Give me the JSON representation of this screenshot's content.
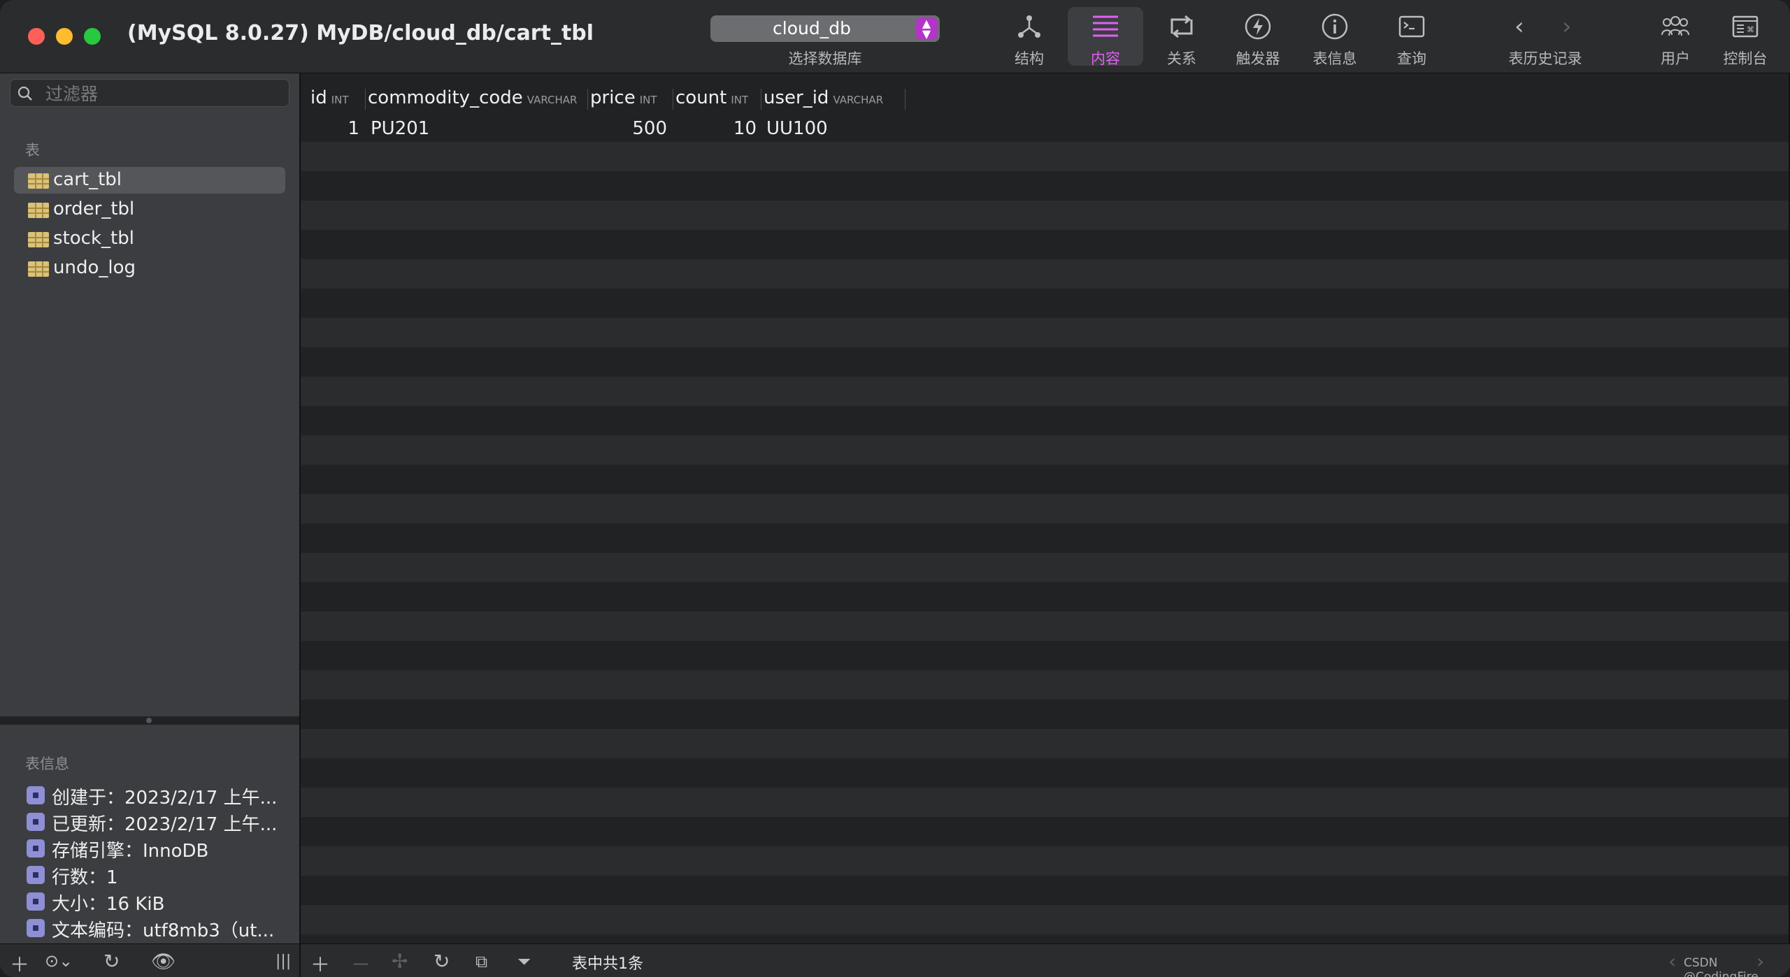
{
  "window": {
    "title": "(MySQL 8.0.27) MyDB/cloud_db/cart_tbl"
  },
  "toolbar": {
    "database": {
      "selected": "cloud_db",
      "label": "选择数据库"
    },
    "tools": [
      {
        "id": "structure",
        "label": "结构",
        "icon": "structure-icon",
        "active": false
      },
      {
        "id": "content",
        "label": "内容",
        "icon": "content-list-icon",
        "active": true
      },
      {
        "id": "relations",
        "label": "关系",
        "icon": "relations-icon",
        "active": false
      },
      {
        "id": "triggers",
        "label": "触发器",
        "icon": "trigger-bolt-icon",
        "active": false
      },
      {
        "id": "tableinfo",
        "label": "表信息",
        "icon": "info-icon",
        "active": false
      },
      {
        "id": "query",
        "label": "查询",
        "icon": "terminal-icon",
        "active": false
      }
    ],
    "history_label": "表历史记录",
    "users_label": "用户",
    "console_label": "控制台"
  },
  "sidebar": {
    "filter_placeholder": "过滤器",
    "tables_header": "表",
    "tables": [
      {
        "name": "cart_tbl",
        "selected": true
      },
      {
        "name": "order_tbl",
        "selected": false
      },
      {
        "name": "stock_tbl",
        "selected": false
      },
      {
        "name": "undo_log",
        "selected": false
      }
    ],
    "info_header": "表信息",
    "info": [
      "创建于：2023/2/17 上午...",
      "已更新：2023/2/17 上午...",
      "存储引擎：InnoDB",
      "行数：1",
      "大小：16 KiB",
      "文本编码：utf8mb3（ut..."
    ]
  },
  "grid": {
    "columns": [
      {
        "name": "id",
        "type": "INT"
      },
      {
        "name": "commodity_code",
        "type": "VARCHAR"
      },
      {
        "name": "price",
        "type": "INT"
      },
      {
        "name": "count",
        "type": "INT"
      },
      {
        "name": "user_id",
        "type": "VARCHAR"
      }
    ],
    "rows": [
      [
        "1",
        "PU201",
        "500",
        "10",
        "UU100"
      ]
    ]
  },
  "status": {
    "row_count_text": "表中共1条"
  },
  "watermark": "CSDN @CodingFire",
  "colors": {
    "accent": "#e45ff5",
    "select_arrows": "#b334c7",
    "row_even": "#202224",
    "row_odd": "#2a2c2e"
  }
}
